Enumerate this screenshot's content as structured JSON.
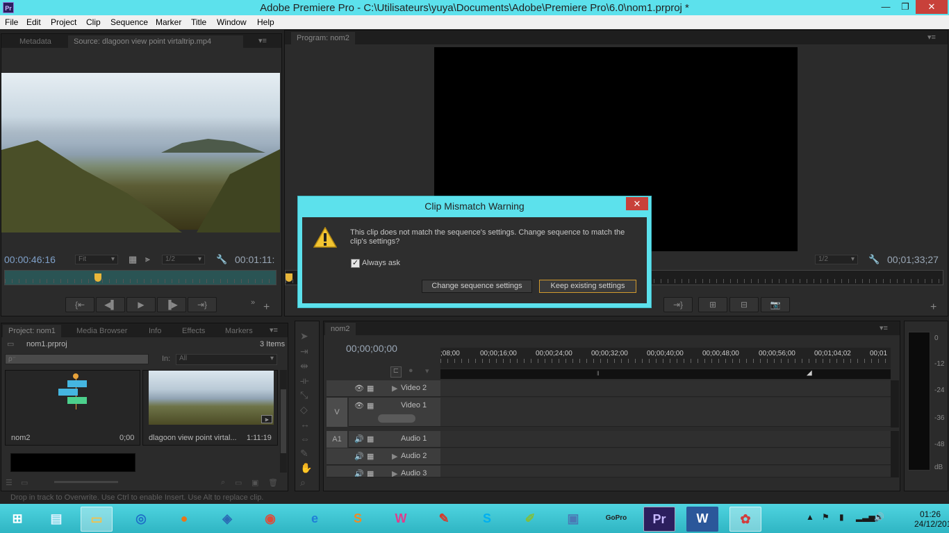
{
  "window": {
    "title": "Adobe Premiere Pro - C:\\Utilisateurs\\yuya\\Documents\\Adobe\\Premiere Pro\\6.0\\nom1.prproj *",
    "app_badge": "Pr",
    "min": "—",
    "max": "❐",
    "close": "✕"
  },
  "menu": [
    "File",
    "Edit",
    "Project",
    "Clip",
    "Sequence",
    "Marker",
    "Title",
    "Window",
    "Help"
  ],
  "source_panel": {
    "tabs": [
      "Metadata",
      "Source: dlagoon view point virtaltrip.mp4"
    ],
    "timecode_in": "00:00:46:16",
    "timecode_dur": "00:01:11:",
    "fit": "Fit",
    "res": "1/2"
  },
  "program_panel": {
    "tab": "Program: nom2",
    "res": "1/2",
    "timecode": "00;01;33;27"
  },
  "project_panel": {
    "tabs": [
      "Project: nom1",
      "Media Browser",
      "Info",
      "Effects",
      "Markers"
    ],
    "project_file": "nom1.prproj",
    "item_count": "3 Items",
    "search_placeholder": "ρ⁻",
    "in_label": "In:",
    "in_value": "All",
    "items": [
      {
        "name": "nom2",
        "duration": "0;00"
      },
      {
        "name": "dlagoon view point virtal...",
        "duration": "1:11:19"
      }
    ]
  },
  "timeline": {
    "tab": "nom2",
    "timecode": "00;00;00;00",
    "ruler": [
      ";08;00",
      "00;00;16;00",
      "00;00;24;00",
      "00;00;32;00",
      "00;00;40;00",
      "00;00;48;00",
      "00;00;56;00",
      "00;01;04;02",
      "00;01"
    ],
    "target_v": "V",
    "target_a": "A1",
    "tracks": [
      "Video 2",
      "Video 1",
      "Audio 1",
      "Audio 2",
      "Audio 3"
    ]
  },
  "meter": {
    "labels": [
      "0",
      "-12",
      "-24",
      "-36",
      "-48",
      "dB"
    ]
  },
  "dialog": {
    "title": "Clip Mismatch Warning",
    "close": "✕",
    "message": "This clip does not match the sequence's settings. Change sequence to match the clip's settings?",
    "checkbox_label": "Always ask",
    "checkbox_checked": "✓",
    "btn_change": "Change sequence settings",
    "btn_keep": "Keep existing settings"
  },
  "status": "Drop in track to Overwrite. Use Ctrl to enable Insert. Use Alt to replace clip.",
  "taskbar": {
    "icons": [
      "start-icon",
      "file-explorer-icon",
      "folder-icon",
      "safari-icon",
      "firefox-icon",
      "virtualbox-icon",
      "chrome-icon",
      "internet-explorer-icon",
      "sublime-icon",
      "wamp-icon",
      "ccleaner-icon",
      "skype-icon",
      "notepadpp-icon",
      "remote-desktop-icon",
      "gopro-icon",
      "premiere-icon",
      "word-icon",
      "paint-icon"
    ],
    "time": "01:26",
    "date": "24/12/2014"
  }
}
